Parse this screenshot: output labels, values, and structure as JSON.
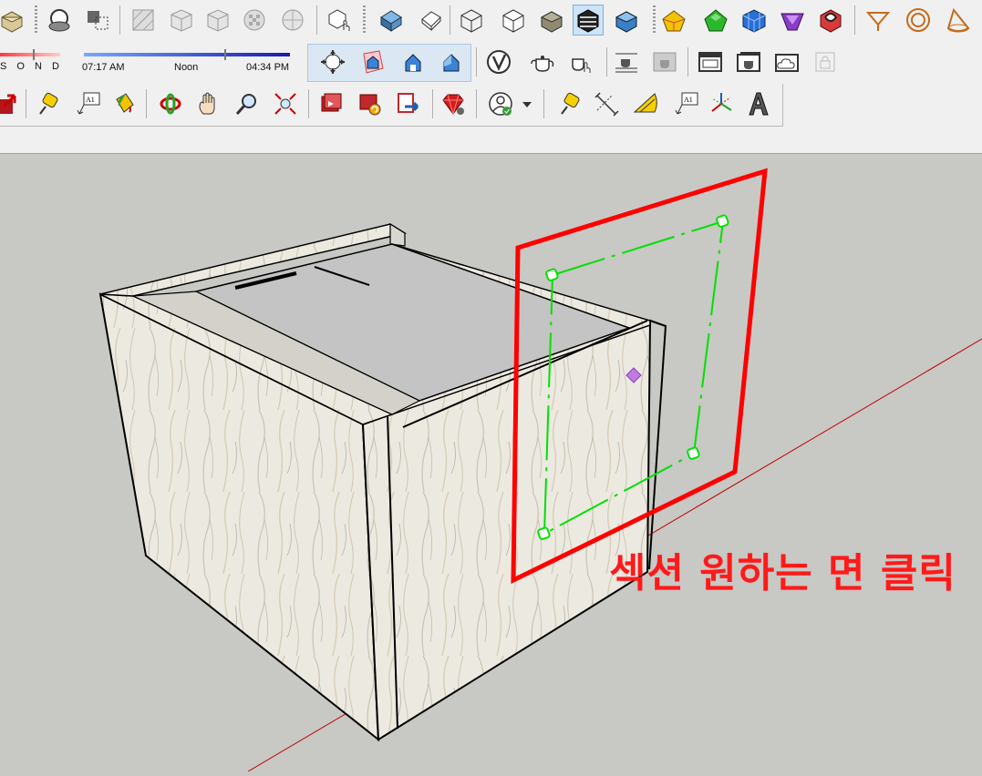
{
  "app": "SketchUp",
  "shadow_settings": {
    "months_label": "S O N D",
    "time_start": "07:17 AM",
    "time_mid": "Noon",
    "time_end": "04:34 PM"
  },
  "toolbar_row1": [
    "3D Warehouse",
    "Section Plane",
    "Section Cuts",
    "X-Ray",
    "Back Edges",
    "Wireframe",
    "Hidden Line",
    "Components",
    "Iso",
    "Top",
    "Front",
    "Right",
    "Wireframe Style",
    "Hidden Line Style",
    "Shaded",
    "Shaded With Textures",
    "Monochrome",
    "Union",
    "Subtract",
    "Intersect",
    "Trim",
    "Split",
    "Section",
    "Circle",
    "Cone"
  ],
  "toolbar_row2": [
    "Show Shadows",
    "Position Camera",
    "Walk",
    "Look Around",
    "Zoom Extents",
    "V-Ray",
    "Render",
    "Interactive Render",
    "Viewer",
    "Frame Buffer",
    "Batch Render",
    "Cloud",
    "Lock"
  ],
  "toolbar_row3": [
    "Move",
    "Tape Measure",
    "Text",
    "Paint Bucket",
    "Orbit",
    "Pan",
    "Zoom",
    "Zoom Extents",
    "Add Scene",
    "Update Scene",
    "Export",
    "Extension Warehouse",
    "Account",
    "Tape Measure",
    "Dimension",
    "Protractor",
    "Text",
    "Axes",
    "3D Text"
  ],
  "annotation": {
    "text": "섹션 원하는 면 클릭",
    "color": "#ff1a1a"
  },
  "colors": {
    "section_plane_red": "#ff0000",
    "section_green": "#00e000",
    "axis_red": "#c00000",
    "viewport_bg": "#c8c8c4"
  }
}
